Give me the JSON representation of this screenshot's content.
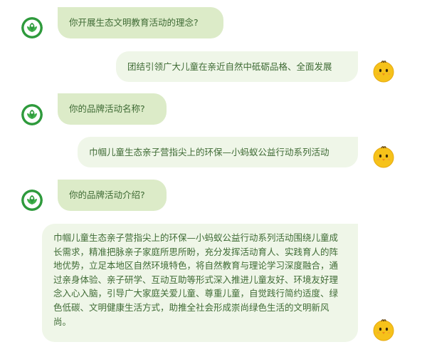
{
  "messages": [
    {
      "role": "question",
      "text": "你开展生态文明教育活动的理念?"
    },
    {
      "role": "answer",
      "text": "团结引领广大儿童在亲近自然中砥砺品格、全面发展"
    },
    {
      "role": "question",
      "text": "你的品牌活动名称?"
    },
    {
      "role": "answer",
      "text": "巾帼儿童生态亲子营指尖上的环保—小蚂蚁公益行动系列活动"
    },
    {
      "role": "question",
      "text": "你的品牌活动介绍?"
    },
    {
      "role": "answer",
      "text": "巾帼儿童生态亲子营指尖上的环保—小蚂蚁公益行动系列活动围绕儿童成长需求，精准把脉亲子家庭所思所盼，充分发挥活动育人、实践育人的阵地优势，立足本地区自然环境特色，将自然教育与理论学习深度融合，通过亲身体验、亲子研学、互动互助等形式深入推进儿童友好、环境友好理念入心入脑，引导广大家庭关爱儿童、尊重儿童，自觉践行简约适度、绿色低碳、文明健康生活方式，助推全社会形成崇尚绿色生活的文明新风尚。"
    }
  ],
  "icons": {
    "org_avatar": "green-leaf-logo-icon",
    "user_avatar": "yellow-chick-icon"
  },
  "colors": {
    "question_bubble": "#dcebc8",
    "answer_bubble": "#eff6e8",
    "text": "#3f6b35",
    "logo_green": "#2e9a3c",
    "chick_yellow": "#f6c21a"
  }
}
